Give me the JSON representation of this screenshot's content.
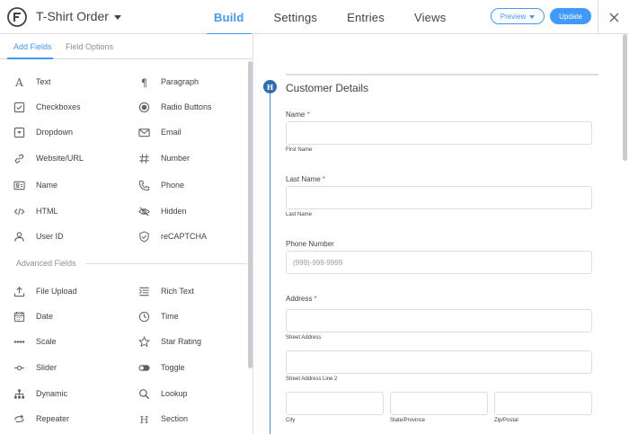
{
  "header": {
    "form_title": "T-Shirt Order",
    "tabs": [
      "Build",
      "Settings",
      "Entries",
      "Views"
    ],
    "active_tab": "Build",
    "preview_label": "Preview",
    "update_label": "Update"
  },
  "sidebar": {
    "tabs": [
      "Add Fields",
      "Field Options"
    ],
    "active_tab": "Add Fields",
    "fields": [
      {
        "label": "Text",
        "icon": "text-icon"
      },
      {
        "label": "Paragraph",
        "icon": "paragraph-icon"
      },
      {
        "label": "Checkboxes",
        "icon": "checkbox-icon"
      },
      {
        "label": "Radio Buttons",
        "icon": "radio-icon"
      },
      {
        "label": "Dropdown",
        "icon": "dropdown-icon"
      },
      {
        "label": "Email",
        "icon": "email-icon"
      },
      {
        "label": "Website/URL",
        "icon": "link-icon"
      },
      {
        "label": "Number",
        "icon": "hash-icon"
      },
      {
        "label": "Name",
        "icon": "name-card-icon"
      },
      {
        "label": "Phone",
        "icon": "phone-icon"
      },
      {
        "label": "HTML",
        "icon": "code-icon"
      },
      {
        "label": "Hidden",
        "icon": "eye-slash-icon"
      },
      {
        "label": "User ID",
        "icon": "user-icon"
      },
      {
        "label": "reCAPTCHA",
        "icon": "shield-icon"
      }
    ],
    "advanced_label": "Advanced Fields",
    "advanced_fields": [
      {
        "label": "File Upload",
        "icon": "upload-icon"
      },
      {
        "label": "Rich Text",
        "icon": "rich-text-icon"
      },
      {
        "label": "Date",
        "icon": "calendar-icon"
      },
      {
        "label": "Time",
        "icon": "clock-icon"
      },
      {
        "label": "Scale",
        "icon": "scale-icon"
      },
      {
        "label": "Star Rating",
        "icon": "star-icon"
      },
      {
        "label": "Slider",
        "icon": "slider-icon"
      },
      {
        "label": "Toggle",
        "icon": "toggle-icon"
      },
      {
        "label": "Dynamic",
        "icon": "sitemap-icon"
      },
      {
        "label": "Lookup",
        "icon": "search-icon"
      },
      {
        "label": "Repeater",
        "icon": "repeater-icon"
      },
      {
        "label": "Section",
        "icon": "heading-icon"
      }
    ]
  },
  "form": {
    "section_badge": "H",
    "section_title": "Customer Details",
    "name_label": "Name",
    "first_name_sub": "First Name",
    "last_name_label": "Last Name",
    "last_name_sub": "Last Name",
    "required_mark": "*",
    "phone_label": "Phone Number",
    "phone_placeholder": "(999)-999-9999",
    "address_label": "Address",
    "street_sub": "Street Address",
    "street2_sub": "Street Address Line 2",
    "city_sub": "City",
    "state_sub": "State/Province",
    "zip_sub": "Zip/Postal"
  },
  "colors": {
    "accent": "#4199fd",
    "badge": "#2e6db4",
    "required": "#e04b4b"
  }
}
